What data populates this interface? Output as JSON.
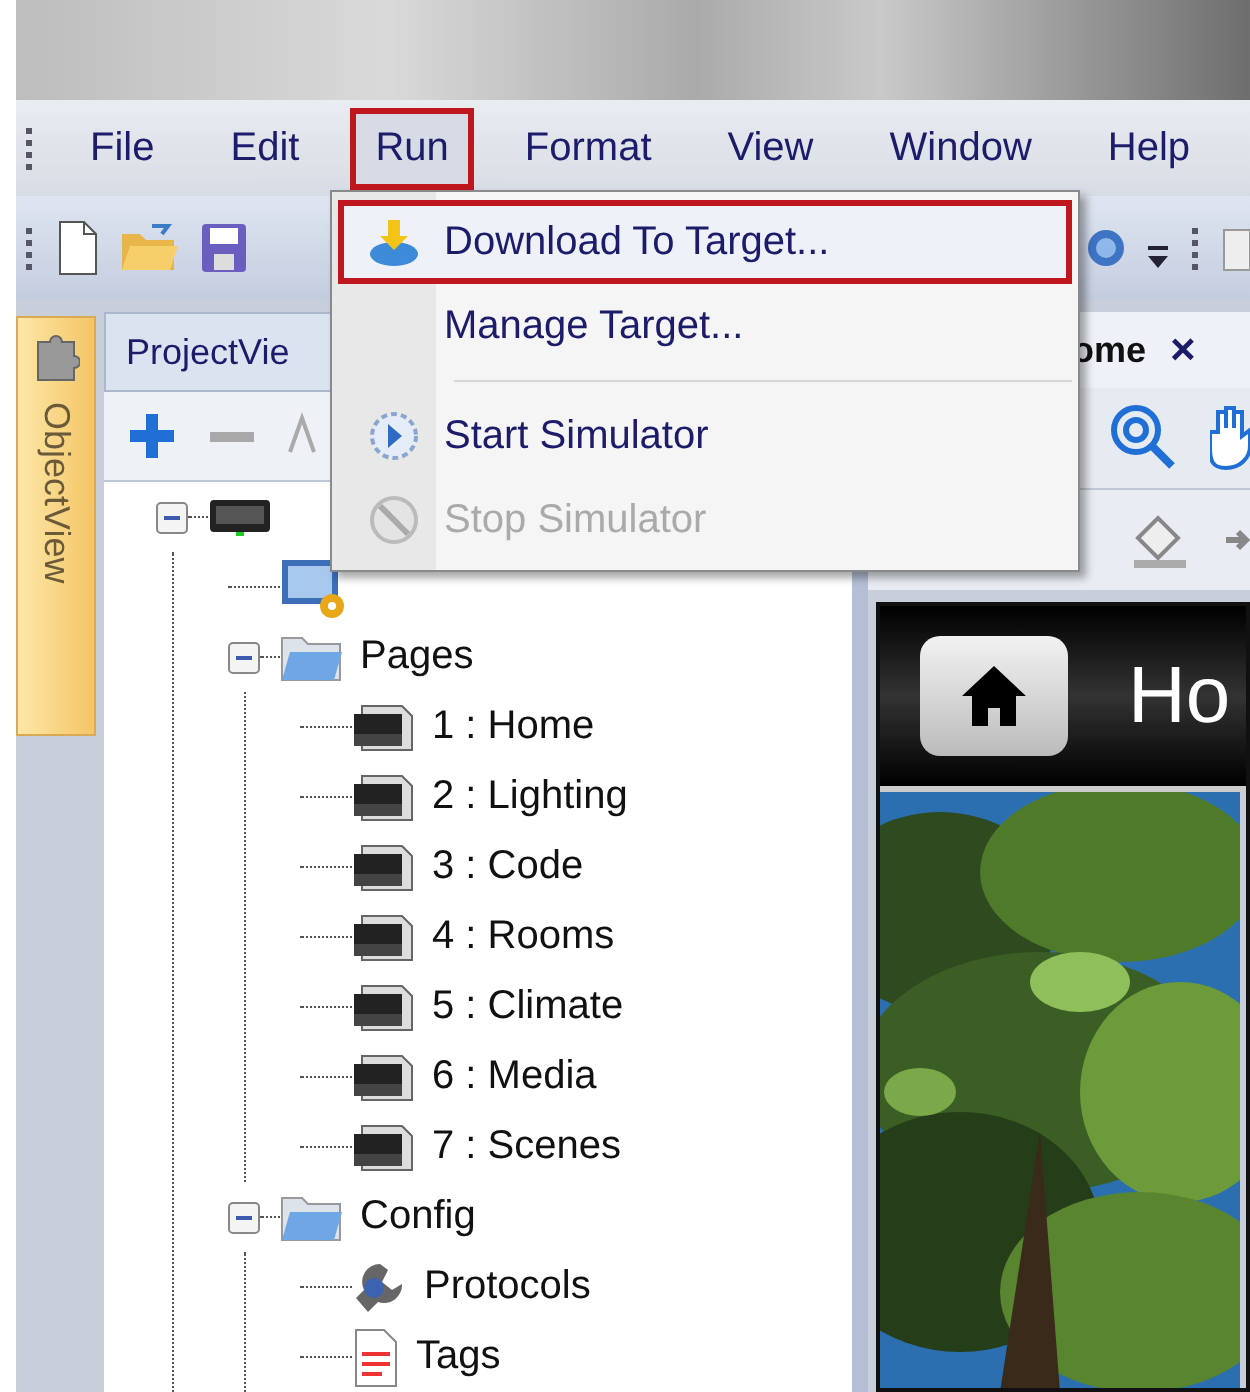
{
  "menu_bar": {
    "items": [
      {
        "label": "File",
        "selected": false
      },
      {
        "label": "Edit",
        "selected": false
      },
      {
        "label": "Run",
        "selected": true
      },
      {
        "label": "Format",
        "selected": false
      },
      {
        "label": "View",
        "selected": false
      },
      {
        "label": "Window",
        "selected": false
      },
      {
        "label": "Help",
        "selected": false
      }
    ]
  },
  "run_menu": {
    "items": [
      {
        "kind": "download",
        "label": "Download To Target...",
        "highlighted": true,
        "disabled": false
      },
      {
        "kind": "plain",
        "label": "Manage Target...",
        "highlighted": false,
        "disabled": false
      },
      {
        "kind": "separator"
      },
      {
        "kind": "start",
        "label": "Start Simulator",
        "highlighted": false,
        "disabled": false
      },
      {
        "kind": "stop",
        "label": "Stop Simulator",
        "highlighted": false,
        "disabled": true
      }
    ]
  },
  "object_view_tab": {
    "label": "ObjectView"
  },
  "project_view": {
    "title": "ProjectVie",
    "tree": [
      {
        "kind": "device",
        "expanded": true,
        "children": [
          {
            "kind": "screen"
          },
          {
            "kind": "folder",
            "label": "Pages",
            "expanded": true,
            "children": [
              {
                "kind": "page",
                "label": "1 : Home"
              },
              {
                "kind": "page",
                "label": "2 : Lighting"
              },
              {
                "kind": "page",
                "label": "3 : Code"
              },
              {
                "kind": "page",
                "label": "4 : Rooms"
              },
              {
                "kind": "page",
                "label": "5 : Climate"
              },
              {
                "kind": "page",
                "label": "6 : Media"
              },
              {
                "kind": "page",
                "label": "7 : Scenes"
              }
            ]
          },
          {
            "kind": "folder",
            "label": "Config",
            "expanded": true,
            "children": [
              {
                "kind": "protocol",
                "label": "Protocols"
              },
              {
                "kind": "tags",
                "label": "Tags"
              }
            ]
          }
        ]
      }
    ]
  },
  "editor": {
    "tab": {
      "label": "ome",
      "close": "×"
    },
    "preview": {
      "title": "Ho"
    }
  }
}
